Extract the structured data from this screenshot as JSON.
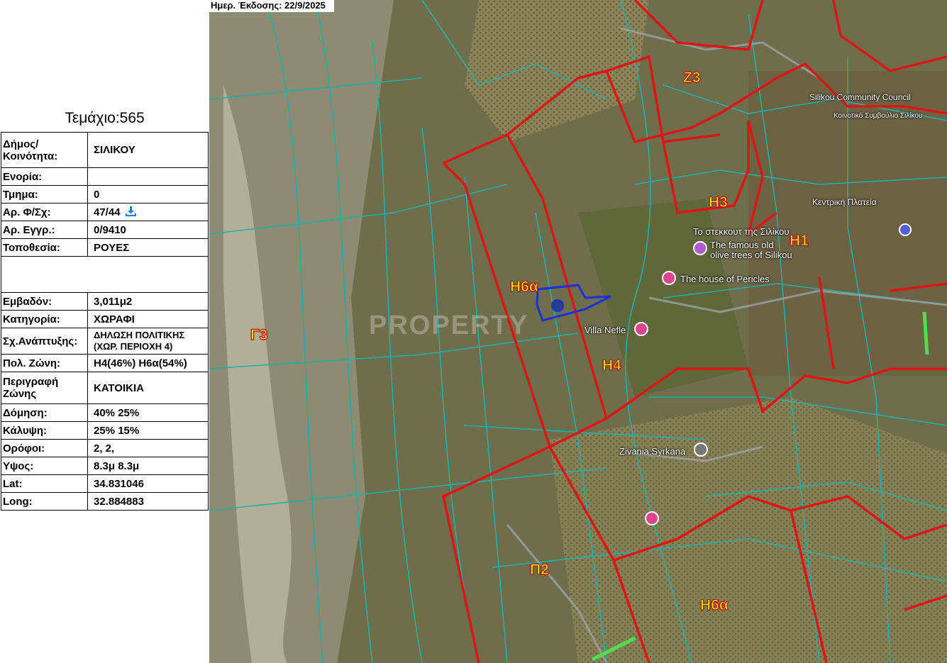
{
  "parcel_title": "Τεμάχιο:565",
  "issue_date": "Ημερ. Έκδοσης: 22/9/2025",
  "table": [
    {
      "label": "Δήμος/ Κοινότητα:",
      "value": "ΣΙΛΙΚΟΥ"
    },
    {
      "label": "Ενορία:",
      "value": ""
    },
    {
      "label": "Τμημα:",
      "value": "0"
    },
    {
      "label": "Αρ. Φ/Σχ:",
      "value": "47/44"
    },
    {
      "label": "Αρ. Εγγρ.:",
      "value": "0/9410"
    },
    {
      "label": "Τοποθεσία:",
      "value": "ΡΟΥΕΣ"
    },
    {
      "label": "",
      "value": ""
    },
    {
      "label": "Εμβαδόν:",
      "value": "3,011μ2"
    },
    {
      "label": "Κατηγορία:",
      "value": "ΧΩΡΑΦΙ"
    },
    {
      "label": "Σχ.Ανάπτυξης:",
      "value": "ΔΗΛΩΣΗ ΠΟΛΙΤΙΚΗΣ (ΧΩΡ. ΠΕΡΙΟΧΗ 4)"
    },
    {
      "label": "Πολ. Ζώνη:",
      "value": "Η4(46%) Η6α(54%)"
    },
    {
      "label": "Περιγραφή Ζώνης",
      "value": "ΚΑΤΟΙΚΙΑ"
    },
    {
      "label": "Δόμηση:",
      "value": "40% 25%"
    },
    {
      "label": "Κάλυψη:",
      "value": "25% 15%"
    },
    {
      "label": "Ορόφοι:",
      "value": "2, 2,"
    },
    {
      "label": "Υψος:",
      "value": "8.3μ 8.3μ"
    },
    {
      "label": "Lat:",
      "value": "34.831046"
    },
    {
      "label": "Long:",
      "value": "32.884883"
    }
  ],
  "icons": {
    "download": "download-icon"
  },
  "zones": {
    "z3": "Ζ3",
    "h3": "Η3",
    "h1": "Η1",
    "h6a_top": "Η6α",
    "g3": "Γ3",
    "h4": "Η4",
    "p2": "Π2",
    "h6a_bottom": "Η6α"
  },
  "pois": {
    "community_council": "Silikou Community Council",
    "community_council_gr": "Κοινοτικό Συμβούλιο Σιλίκου",
    "square": "Κεντρική Πλατεία",
    "olive_gr": "Το στεκκουτ της Σιλίκου",
    "olive_en1": "The famous old",
    "olive_en2": "olive trees of Silikou",
    "pericles": "The house of Pericles",
    "villa": "Villa Nefle",
    "zivania": "Zivania Syrkana"
  },
  "watermark": "PROPERTY",
  "colors": {
    "zone_border": "#e01414",
    "parcel_border": "#1fb0a8",
    "selected_parcel": "#1a2fe0",
    "zone_label": "#ffe000",
    "poi_marker": "#e0448c"
  }
}
